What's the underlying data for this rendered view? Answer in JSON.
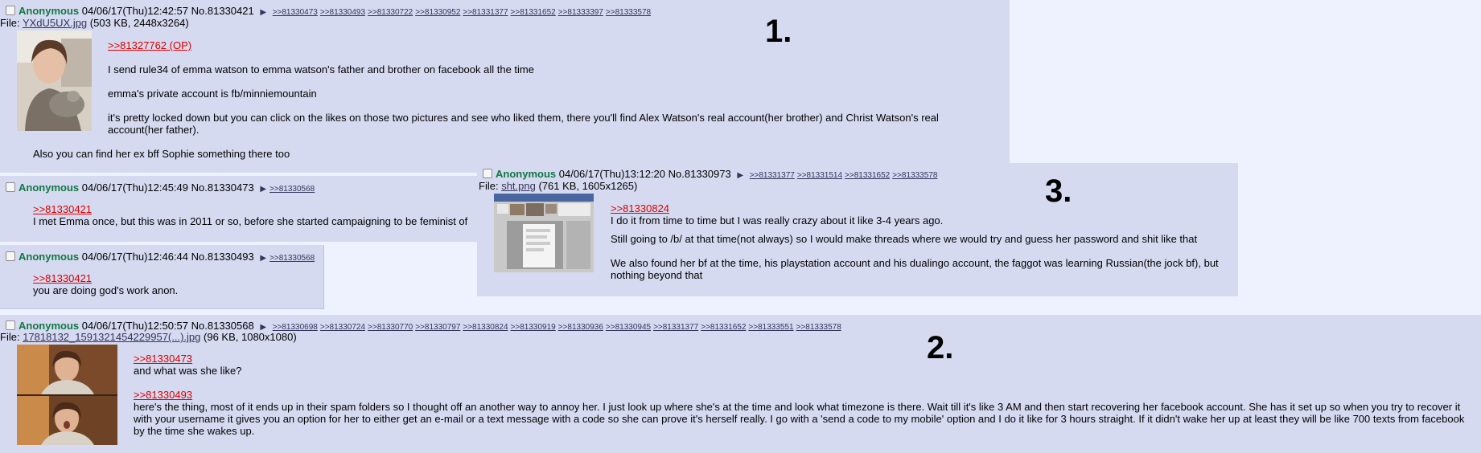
{
  "post1": {
    "name": "Anonymous",
    "datetime": "04/06/17(Thu)12:42:57",
    "number": "No.81330421",
    "replies": [
      ">>81330473",
      ">>81330493",
      ">>81330722",
      ">>81330952",
      ">>81331377",
      ">>81331652",
      ">>81333397",
      ">>81333578"
    ],
    "file_label": "File:",
    "file_name": "YXdU5UX.jpg",
    "file_meta": "(503 KB, 2448x3264)",
    "quote": ">>81327762 (OP)",
    "lines": [
      "I send rule34 of emma watson to emma watson's father and brother on facebook all the time",
      "emma's private account is fb/minniemountain",
      "it's pretty locked down but you can click on the likes on those two pictures and see who liked them, there you'll find Alex Watson's real account(her brother) and Christ Watson's real account(her father)."
    ],
    "footer": "Also you can find her ex bff Sophie something there too"
  },
  "post_b": {
    "name": "Anonymous",
    "datetime": "04/06/17(Thu)12:45:49",
    "number": "No.81330473",
    "replies": [
      ">>81330568"
    ],
    "quote": ">>81330421",
    "text": "I met Emma once, but this was in 2011 or so, before she started campaigning to be feminist of"
  },
  "post_c": {
    "name": "Anonymous",
    "datetime": "04/06/17(Thu)12:46:44",
    "number": "No.81330493",
    "replies": [
      ">>81330568"
    ],
    "quote": ">>81330421",
    "text": "you are doing god's work anon."
  },
  "post3": {
    "name": "Anonymous",
    "datetime": "04/06/17(Thu)13:12:20",
    "number": "No.81330973",
    "replies": [
      ">>81331377",
      ">>81331514",
      ">>81331652",
      ">>81333578"
    ],
    "file_label": "File:",
    "file_name": "sht.png",
    "file_meta": "(761 KB, 1605x1265)",
    "quote": ">>81330824",
    "lines": [
      "I do it from time to time but I was really crazy about it like 3-4 years ago.",
      "Still going to /b/ at that time(not always) so I would make threads where we would try and guess her password and shit like that",
      "We also found her bf at the time, his playstation account and his dualingo account, the faggot was learning Russian(the jock bf), but nothing beyond that"
    ]
  },
  "post2": {
    "name": "Anonymous",
    "datetime": "04/06/17(Thu)12:50:57",
    "number": "No.81330568",
    "replies": [
      ">>81330698",
      ">>81330724",
      ">>81330770",
      ">>81330797",
      ">>81330824",
      ">>81330919",
      ">>81330936",
      ">>81330945",
      ">>81331377",
      ">>81331652",
      ">>81333551",
      ">>81333578"
    ],
    "file_label": "File:",
    "file_name": "17818132_1591321454229957(...).jpg",
    "file_meta": "(96 KB, 1080x1080)",
    "quote1": ">>81330473",
    "text1": "and what was she like?",
    "quote2": ">>81330493",
    "text2": "here's the thing, most of it ends up in their spam folders so I thought off an another way to annoy her. I just look up where she's at the time and look what timezone is there. Wait till it's like 3 AM and then start recovering her facebook account. She has it set up so when you try to recover it with your username it gives you an option for her to either get an e-mail or a text message with a code so she can prove it's herself really. I go with a 'send a code to my mobile' option and I do it like for 3 hours straight. If it didn't wake her up at least they will be like 700 texts from facebook by the time she wakes up."
  },
  "annotations": {
    "one": "1.",
    "two": "2.",
    "three": "3."
  },
  "colors": {
    "post_bg": "#d6daf0",
    "page_bg": "#eef2ff",
    "name": "#117743",
    "quotelink": "#dd0000",
    "link": "#34345c"
  }
}
